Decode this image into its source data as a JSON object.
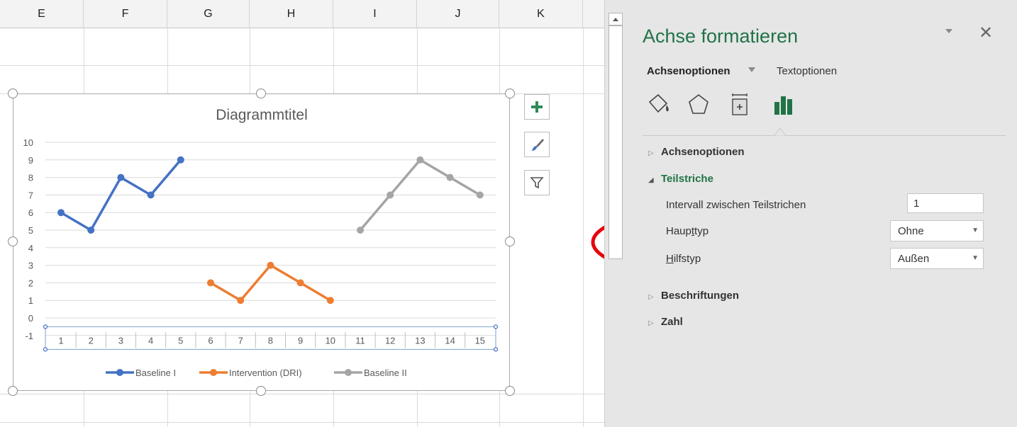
{
  "sheet": {
    "columns": [
      "E",
      "F",
      "G",
      "H",
      "I",
      "J",
      "K"
    ]
  },
  "chart": {
    "title": "Diagrammtitel",
    "side_buttons": [
      "plus-icon",
      "brush-icon",
      "filter-icon"
    ]
  },
  "chart_data": {
    "type": "line",
    "title": "Diagrammtitel",
    "x": [
      1,
      2,
      3,
      4,
      5,
      6,
      7,
      8,
      9,
      10,
      11,
      12,
      13,
      14,
      15
    ],
    "y_ticks": [
      -1,
      0,
      1,
      2,
      3,
      4,
      5,
      6,
      7,
      8,
      9,
      10
    ],
    "ylim": [
      -1,
      10
    ],
    "grid": true,
    "legend_position": "bottom",
    "series": [
      {
        "name": "Baseline I",
        "color": "#4472C4",
        "x": [
          1,
          2,
          3,
          4,
          5
        ],
        "values": [
          6,
          5,
          8,
          7,
          9
        ]
      },
      {
        "name": "Intervention (DRI)",
        "color": "#ED7D31",
        "x": [
          6,
          7,
          8,
          9,
          10
        ],
        "values": [
          2,
          1,
          3,
          2,
          1
        ]
      },
      {
        "name": "Baseline II",
        "color": "#A5A5A5",
        "x": [
          11,
          12,
          13,
          14,
          15
        ],
        "values": [
          5,
          7,
          9,
          8,
          7
        ]
      }
    ]
  },
  "pane": {
    "title": "Achse formatieren",
    "tabs": {
      "axis_options": "Achsenoptionen",
      "text_options": "Textoptionen"
    },
    "icons": [
      "fill-line-icon",
      "effects-icon",
      "size-properties-icon",
      "axis-options-icon"
    ],
    "sections": {
      "axis_options": "Achsenoptionen",
      "tick_marks": "Teilstriche",
      "labels": "Beschriftungen",
      "number": "Zahl"
    },
    "tick_marks": {
      "interval_label": "Intervall zwischen Teilstrichen",
      "interval_value": "1",
      "major_label_pre": "Haup",
      "major_label_ul": "t",
      "major_label_post": "typ",
      "major_value": "Ohne",
      "minor_label_ul": "H",
      "minor_label_post": "ilfstyp",
      "minor_value": "Außen"
    },
    "highlight_color": "#E8000B"
  }
}
